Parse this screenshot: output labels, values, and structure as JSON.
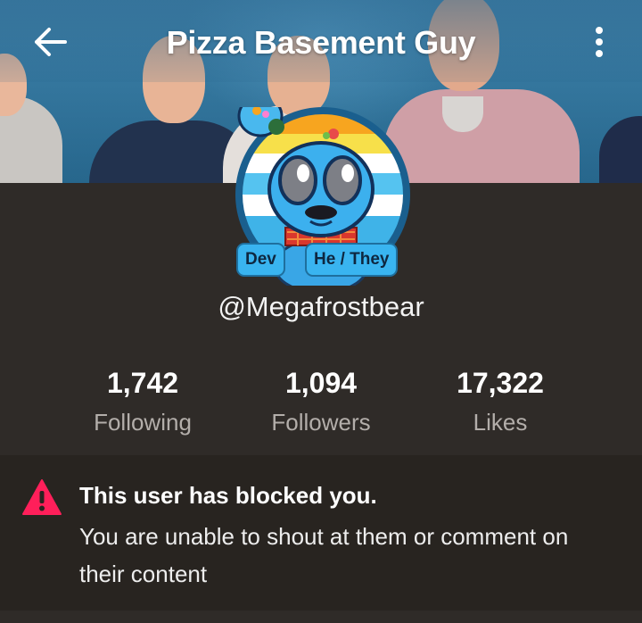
{
  "header": {
    "title": "Pizza Basement Guy",
    "back_icon": "arrow-left-icon",
    "menu_icon": "more-vertical-icon"
  },
  "profile": {
    "badges": [
      "Dev",
      "He / They"
    ],
    "username": "@Megafrostbear"
  },
  "stats": [
    {
      "value": "1,742",
      "label": "Following"
    },
    {
      "value": "1,094",
      "label": "Followers"
    },
    {
      "value": "17,322",
      "label": "Likes"
    }
  ],
  "notice": {
    "title": "This user has blocked you.",
    "body": "You are unable to shout at them or comment on their content",
    "icon": "warning-triangle-icon",
    "icon_color": "#ff1f5a"
  },
  "colors": {
    "background": "#2f2b28",
    "notice_background": "#282420",
    "badge": "#39b4f0",
    "muted_text": "#b3aeaa"
  }
}
